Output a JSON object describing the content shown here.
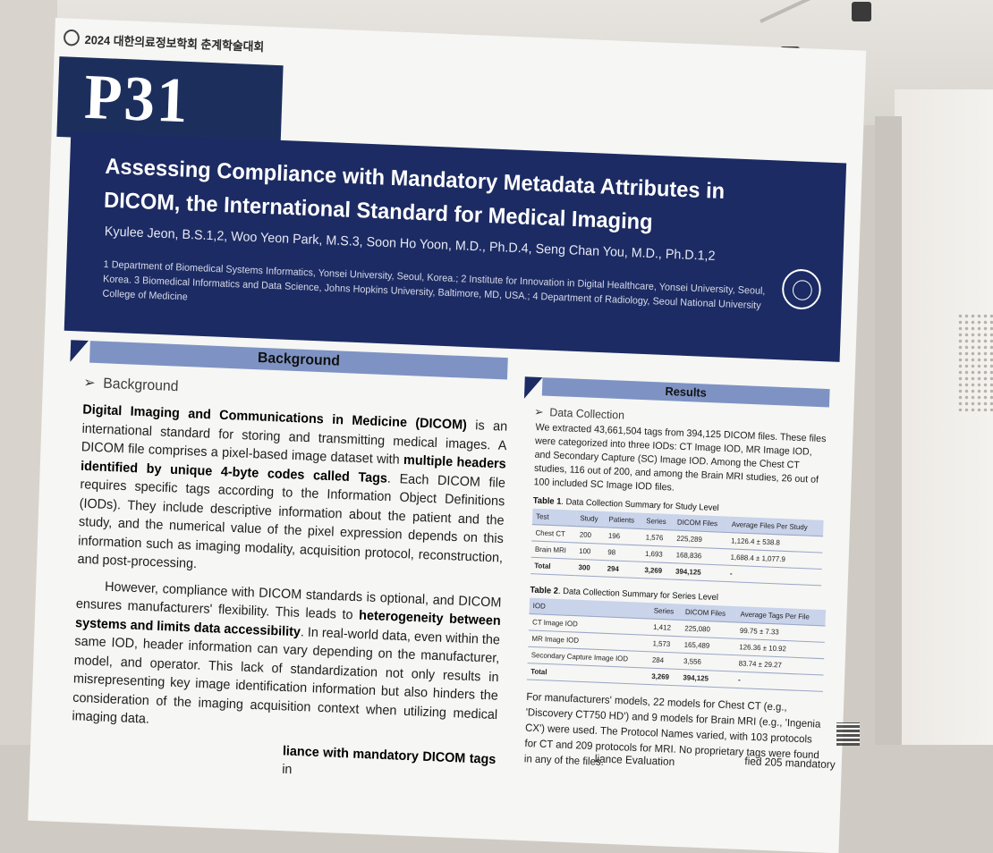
{
  "conference": "2024 대한의료정보학회 춘계학술대회",
  "poster_number": "P31",
  "title": "Assessing Compliance with Mandatory Metadata Attributes in DICOM, the International Standard for Medical Imaging",
  "authors": "Kyulee Jeon, B.S.1,2, Woo Yeon Park, M.S.3, Soon Ho Yoon, M.D., Ph.D.4, Seng Chan You, M.D., Ph.D.1,2",
  "affiliations": "1 Department of Biomedical Systems Informatics, Yonsei University, Seoul, Korea.; 2 Institute for Innovation in Digital Healthcare, Yonsei University, Seoul, Korea. 3 Biomedical Informatics and Data Science, Johns Hopkins University, Baltimore, MD, USA.; 4 Department of Radiology, Seoul National University College of Medicine",
  "background": {
    "header": "Background",
    "subheading": "Background",
    "p1_b1": "Digital Imaging and Communications in Medicine (DICOM)",
    "p1_t1": " is an international standard for storing and transmitting medical images. A DICOM file comprises a pixel-based image dataset with ",
    "p1_b2": "multiple headers identified by unique 4-byte codes called Tags",
    "p1_t2": ". Each DICOM file requires specific tags according to the Information Object Definitions (IODs). They include descriptive information about the patient and the study, and the numerical value of the pixel expression depends on this information such as imaging modality, acquisition protocol, reconstruction, and post-processing.",
    "p2_t1": "However, compliance with DICOM standards is optional, and DICOM ensures manufacturers' flexibility. This leads to ",
    "p2_b1": "heterogeneity between systems and limits data accessibility",
    "p2_t2": ". In real-world data, even within the same IOD, header information can vary depending on the manufacturer, model, and operator. This lack of standardization not only results in misrepresenting key image identification information but also hinders the consideration of the imaging acquisition context when utilizing medical imaging data.",
    "cut_b": "liance with mandatory DICOM tags",
    "cut_t": " in"
  },
  "results": {
    "header": "Results",
    "subheading": "Data Collection",
    "intro": "We extracted 43,661,504 tags from 394,125 DICOM files. These files were categorized into three IODs: CT Image IOD, MR Image IOD, and Secondary Capture (SC) Image IOD. Among the Chest CT studies, 116 out of 200, and among the Brain MRI studies, 26 out of 100 included SC Image IOD files.",
    "table1": {
      "caption_b": "Table 1",
      "caption_t": ". Data Collection Summary for Study Level",
      "headers": [
        "Test",
        "Study",
        "Patients",
        "Series",
        "DICOM Files",
        "Average Files Per Study"
      ],
      "rows": [
        [
          "Chest CT",
          "200",
          "196",
          "1,576",
          "225,289",
          "1,126.4 ± 538.8"
        ],
        [
          "Brain MRI",
          "100",
          "98",
          "1,693",
          "168,836",
          "1,688.4 ± 1,077.9"
        ],
        [
          "Total",
          "300",
          "294",
          "3,269",
          "394,125",
          "-"
        ]
      ]
    },
    "table2": {
      "caption_b": "Table 2",
      "caption_t": ". Data Collection Summary for Series Level",
      "headers": [
        "IOD",
        "Series",
        "DICOM Files",
        "Average Tags Per File"
      ],
      "rows": [
        [
          "CT Image IOD",
          "1,412",
          "225,080",
          "99.75 ± 7.33"
        ],
        [
          "MR Image IOD",
          "1,573",
          "165,489",
          "126.36 ± 10.92"
        ],
        [
          "Secondary Capture Image IOD",
          "284",
          "3,556",
          "83.74 ± 29.27"
        ],
        [
          "Total",
          "3,269",
          "394,125",
          "-"
        ]
      ]
    },
    "models_text": "For manufacturers' models, 22 models for Chest CT (e.g., 'Discovery CT750 HD') and 9 models for Brain MRI (e.g., 'Ingenia CX') were used. The Protocol Names varied, with 103 protocols for CT and 209 protocols for MRI. No proprietary tags were found in any of the files.",
    "cut_eval": "liance Evaluation",
    "cut_mand": "fied 205 mandatory"
  }
}
